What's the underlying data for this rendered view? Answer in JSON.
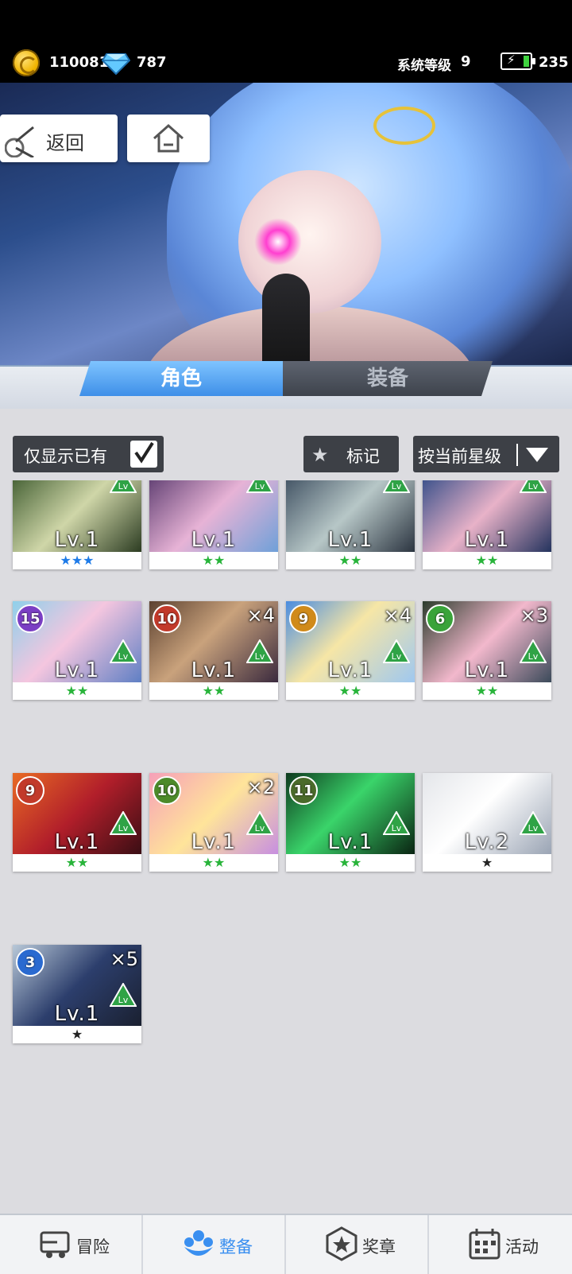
{
  "topbar": {
    "coins": "110081",
    "gems": "787",
    "system_level_label": "系统等级",
    "system_level": "9",
    "energy": "235"
  },
  "nav": {
    "back_label": "返回"
  },
  "tabs": {
    "role": "角色",
    "equipment": "装备"
  },
  "filters": {
    "owned_only_label": "仅显示已有",
    "owned_only_checked": true,
    "mark_label": "标记",
    "sort_label": "按当前星级"
  },
  "cards": [
    {
      "level": "Lv.1",
      "stars": "★★★",
      "star_color": "blue"
    },
    {
      "level": "Lv.1",
      "stars": "★★",
      "star_color": "green"
    },
    {
      "level": "Lv.1",
      "stars": "★★",
      "star_color": "green"
    },
    {
      "level": "Lv.1",
      "stars": "★★",
      "star_color": "green"
    },
    {
      "badge": "15",
      "level": "Lv.1",
      "stars": "★★",
      "star_color": "green"
    },
    {
      "badge": "10",
      "count": "×4",
      "level": "Lv.1",
      "stars": "★★",
      "star_color": "green"
    },
    {
      "badge": "9",
      "count": "×4",
      "level": "Lv.1",
      "stars": "★★",
      "star_color": "green"
    },
    {
      "badge": "6",
      "count": "×3",
      "level": "Lv.1",
      "stars": "★★",
      "star_color": "green"
    },
    {
      "badge": "9",
      "level": "Lv.1",
      "stars": "★★",
      "star_color": "green"
    },
    {
      "badge": "10",
      "count": "×2",
      "level": "Lv.1",
      "stars": "★★",
      "star_color": "green"
    },
    {
      "badge": "11",
      "level": "Lv.1",
      "stars": "★★",
      "star_color": "green"
    },
    {
      "level": "Lv.2",
      "stars": "★",
      "star_color": "black"
    },
    {
      "badge": "3",
      "count": "×5",
      "level": "Lv.1",
      "stars": "★",
      "star_color": "black"
    }
  ],
  "bottom_nav": {
    "adventure": "冒险",
    "formation": "整备",
    "medal": "奖章",
    "events": "活动"
  },
  "colors": {
    "accent": "#3a8ff0",
    "dark_button": "#3d4046"
  }
}
